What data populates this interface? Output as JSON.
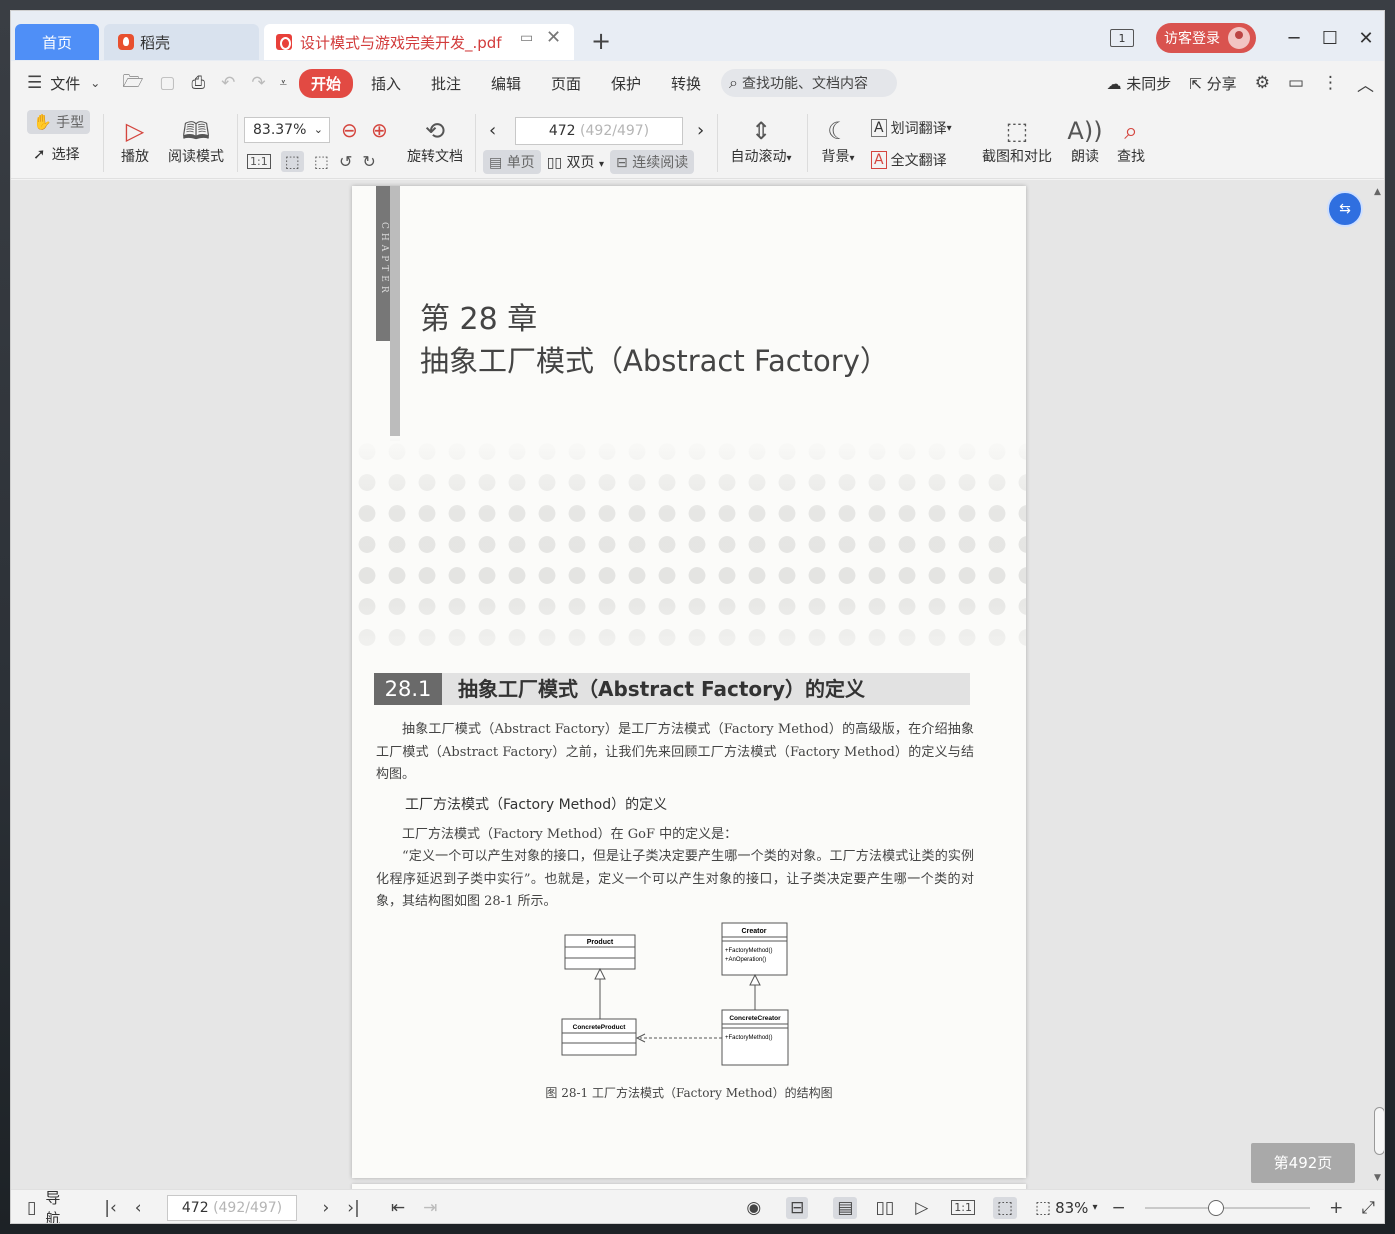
{
  "tabs": {
    "home": "首页",
    "daoke": "稻壳",
    "document": "设计模式与游戏完美开发_.pdf"
  },
  "titlebar": {
    "page_count_badge": "1",
    "login": "访客登录"
  },
  "menu": {
    "file": "文件",
    "items": [
      "开始",
      "插入",
      "批注",
      "编辑",
      "页面",
      "保护",
      "转换"
    ],
    "search_placeholder": "查找功能、文档内容",
    "sync": "未同步",
    "share": "分享"
  },
  "toolbar": {
    "hand": "手型",
    "select": "选择",
    "play": "播放",
    "read_mode": "阅读模式",
    "zoom": "83.37%",
    "rotate": "旋转文档",
    "page_current": "472",
    "page_total": "(492/497)",
    "single": "单页",
    "double": "双页",
    "continuous": "连续阅读",
    "auto_scroll": "自动滚动",
    "background": "背景",
    "word_translate": "划词翻译",
    "full_translate": "全文翻译",
    "screenshot_compare": "截图和对比",
    "read_aloud": "朗读",
    "find": "查找"
  },
  "document": {
    "chapter_strip": "CHAPTER",
    "chapter_number": "第 28 章",
    "chapter_title": "抽象工厂模式（Abstract Factory）",
    "section_number": "28.1",
    "section_title": "抽象工厂模式（Abstract Factory）的定义",
    "para1": "抽象工厂模式（Abstract Factory）是工厂方法模式（Factory Method）的高级版，在介绍抽象工厂模式（Abstract Factory）之前，让我们先来回顾工厂方法模式（Factory Method）的定义与结构图。",
    "subheading": "工厂方法模式（Factory Method）的定义",
    "para2": "工厂方法模式（Factory Method）在 GoF 中的定义是：",
    "para3": "“定义一个可以产生对象的接口，但是让子类决定要产生哪一个类的对象。工厂方法模式让类的实例化程序延迟到子类中实行”。也就是，定义一个可以产生对象的接口，让子类决定要产生哪一个类的对象，其结构图如图 28-1 所示。",
    "uml": {
      "product": "Product",
      "creator": "Creator",
      "creator_ops": [
        "+FactoryMethod()",
        "+AnOperation()"
      ],
      "concrete_product": "ConcreteProduct",
      "concrete_creator": "ConcreteCreator",
      "concrete_creator_ops": [
        "+FactoryMethod()"
      ]
    },
    "caption": "图 28-1    工厂方法模式（Factory Method）的结构图"
  },
  "page_badge": "第492页",
  "statusbar": {
    "nav": "导航",
    "page_current": "472",
    "page_total": "(492/497)",
    "zoom": "83%",
    "zoom_fraction": 0.43
  }
}
